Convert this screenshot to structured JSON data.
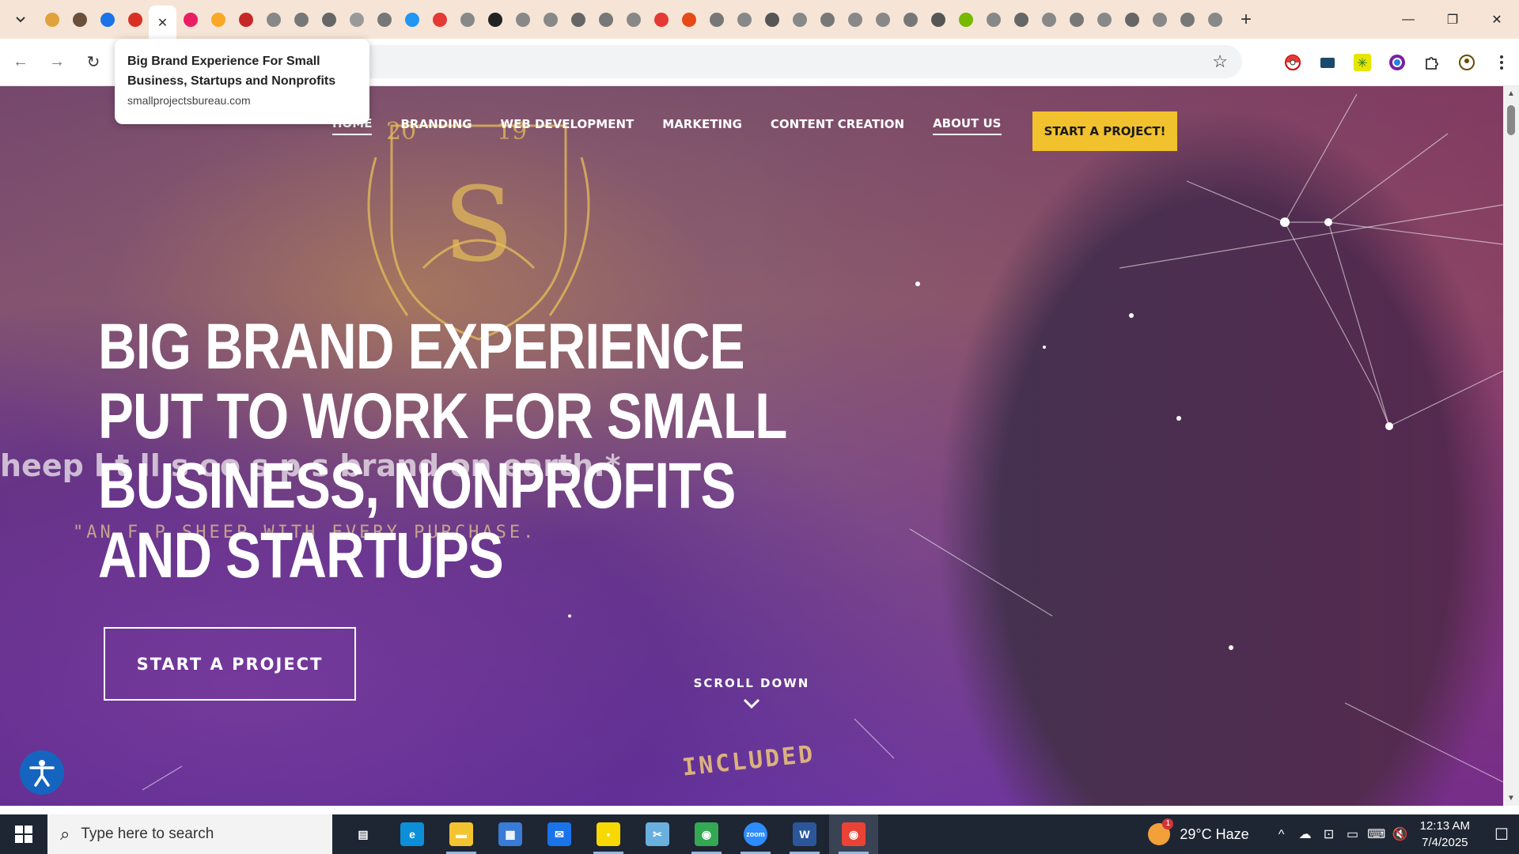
{
  "browser": {
    "tab_icon_colors": [
      "#e2a23b",
      "#6a4f3a",
      "#1a73e8",
      "#d93025",
      "#b5651d",
      "#e91e63",
      "#f9a825",
      "#c62828",
      "#888",
      "#777",
      "#666",
      "#999",
      "#777",
      "#2196f3",
      "#e53935",
      "#888",
      "#222",
      "#888",
      "#888",
      "#666",
      "#777",
      "#888",
      "#e53935",
      "#e64a19",
      "#777",
      "#888",
      "#555",
      "#888",
      "#777",
      "#888",
      "#888",
      "#777",
      "#555",
      "#76b900",
      "#888",
      "#666",
      "#888",
      "#777",
      "#888",
      "#666",
      "#888",
      "#777",
      "#888"
    ],
    "active_tab_close": "✕",
    "new_tab": "+",
    "window_controls": {
      "minimize": "—",
      "restore": "❐",
      "close": "✕"
    },
    "nav": {
      "back": "←",
      "forward": "→",
      "reload": "↻"
    },
    "star": "☆",
    "extension_icons": [
      "pokeball-icon",
      "film-icon",
      "sparkle-icon",
      "color-circle-icon",
      "puzzle-icon",
      "profile-icon",
      "menu-icon"
    ],
    "tooltip": {
      "title": "Big Brand Experience For Small Business, Startups and Nonprofits",
      "url": "smallprojectsbureau.com"
    }
  },
  "site": {
    "nav": [
      {
        "label": "HOME",
        "underlined": true
      },
      {
        "label": "BRANDING",
        "underlined": false
      },
      {
        "label": "WEB DEVELOPMENT",
        "underlined": false
      },
      {
        "label": "MARKETING",
        "underlined": false
      },
      {
        "label": "CONTENT CREATION",
        "underlined": false
      },
      {
        "label": "ABOUT US",
        "underlined": true
      }
    ],
    "cta_top": "START A PROJECT!",
    "bg_text_1": "heep l           t   ll   s   oo     s   p      s     brand on earth.*",
    "bg_text_2": "\"AN    F            P          SHEEP WITH EVERY PURCHASE.",
    "bg_text_3": "INCLUDED",
    "crest_years": [
      "20",
      "19"
    ],
    "headline": [
      "BIG BRAND EXPERIENCE",
      "PUT TO WORK FOR SMALL",
      "BUSINESS, NONPROFITS",
      "AND STARTUPS"
    ],
    "cta_hero": "START A PROJECT",
    "scroll_down": "SCROLL DOWN",
    "accent_yellow": "#f2c12e"
  },
  "taskbar": {
    "search_placeholder": "Type here to search",
    "apps": [
      {
        "name": "task-view",
        "color": "transparent",
        "glyph": "▤",
        "running": false
      },
      {
        "name": "edge",
        "color": "#0c8fd8",
        "glyph": "e",
        "running": false
      },
      {
        "name": "file-explorer",
        "color": "#f4c430",
        "glyph": "▬",
        "running": true
      },
      {
        "name": "microsoft-store",
        "color": "#3a7bd5",
        "glyph": "▦",
        "running": false
      },
      {
        "name": "mail",
        "color": "#1a73e8",
        "glyph": "✉",
        "running": false
      },
      {
        "name": "sticky-notes",
        "color": "#f7d800",
        "glyph": "▪",
        "running": true
      },
      {
        "name": "snipping-tool",
        "color": "#6ab0de",
        "glyph": "✂",
        "running": false
      },
      {
        "name": "chrome-1",
        "color": "#34a853",
        "glyph": "◉",
        "running": true
      },
      {
        "name": "zoom",
        "color": "#2d8cff",
        "glyph": "zoom",
        "running": true
      },
      {
        "name": "word",
        "color": "#2b579a",
        "glyph": "W",
        "running": true
      },
      {
        "name": "chrome-2",
        "color": "#ea4335",
        "glyph": "◉",
        "running": true,
        "current": true
      }
    ],
    "weather": {
      "temp": "29°C",
      "condition": "Haze",
      "badge": "1"
    },
    "tray_icons": [
      "^",
      "☁",
      "⊡",
      "▭",
      "⌨",
      "🔇"
    ],
    "time": "12:13 AM",
    "date": "7/4/2025",
    "notifications_icon": "☐"
  }
}
